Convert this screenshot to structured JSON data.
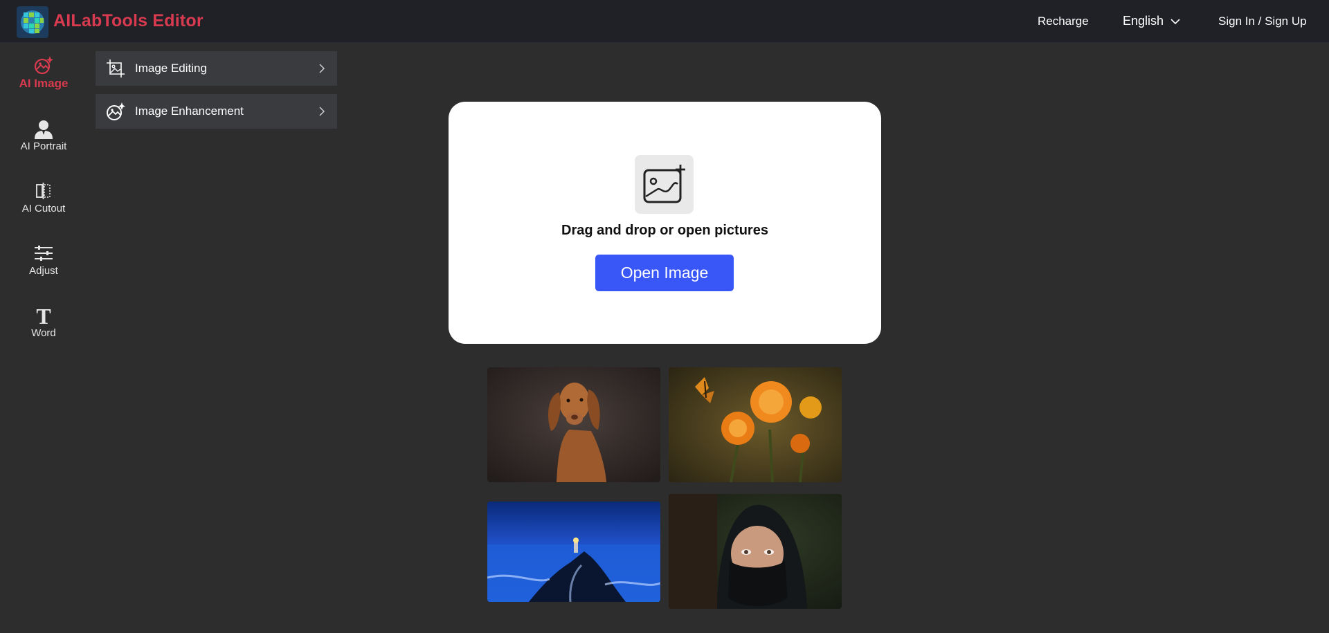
{
  "header": {
    "brand": "AILabTools Editor",
    "recharge": "Recharge",
    "language": "English",
    "signin": "Sign In / Sign Up"
  },
  "rail": {
    "items": [
      {
        "label": "AI Image",
        "icon": "ai-image-icon",
        "active": true
      },
      {
        "label": "AI Portrait",
        "icon": "portrait-icon"
      },
      {
        "label": "AI Cutout",
        "icon": "cutout-icon"
      },
      {
        "label": "Adjust",
        "icon": "sliders-icon"
      },
      {
        "label": "Word",
        "icon": "text-icon"
      }
    ]
  },
  "submenu": {
    "items": [
      {
        "label": "Image Editing",
        "icon": "crop-image-icon"
      },
      {
        "label": "Image Enhancement",
        "icon": "enhance-icon"
      }
    ]
  },
  "upload": {
    "drop_text": "Drag and drop or open pictures",
    "button_label": "Open Image"
  },
  "samples": [
    {
      "subject": "dog-photo"
    },
    {
      "subject": "flowers-butterfly-photo"
    },
    {
      "subject": "lighthouse-photo"
    },
    {
      "subject": "veiled-woman-photo"
    }
  ],
  "colors": {
    "accent": "#d83a4f",
    "button": "#3956f6",
    "background": "#2d2d2d",
    "topbar": "#1f2127"
  }
}
